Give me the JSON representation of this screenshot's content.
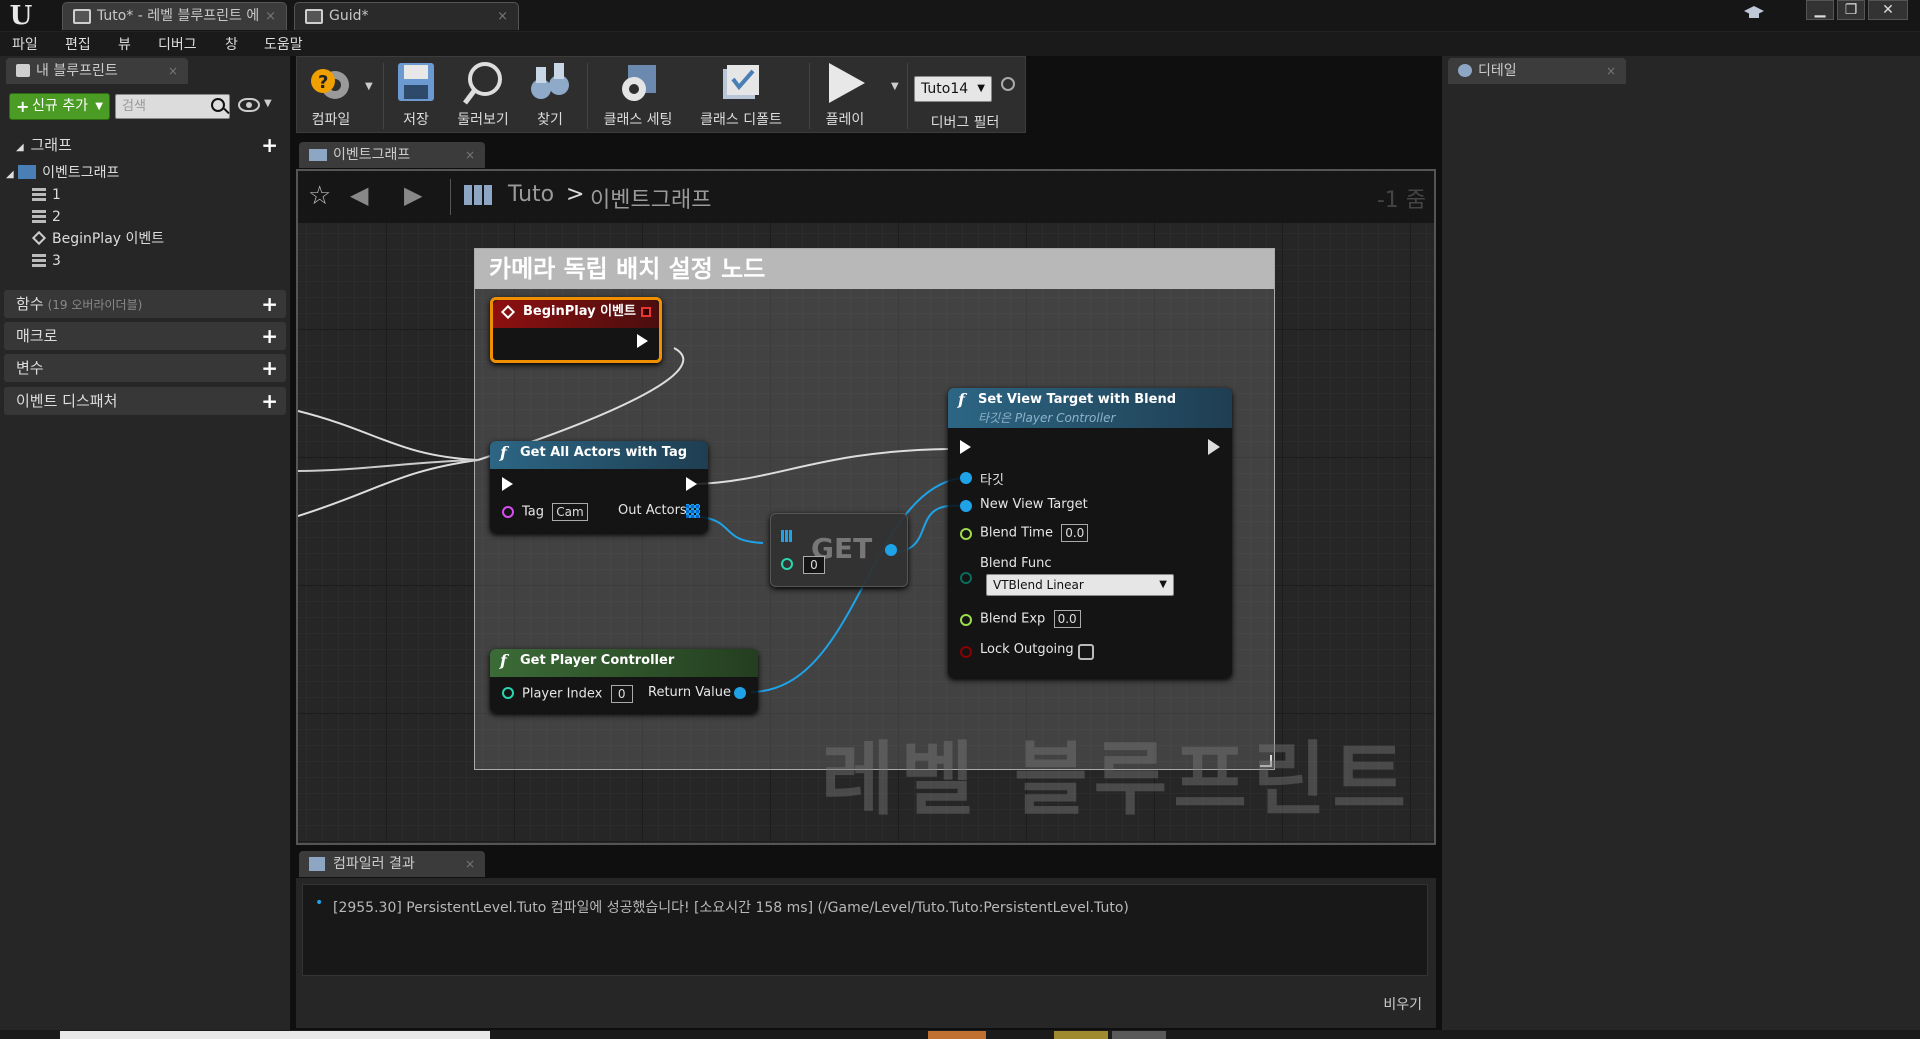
{
  "titlebar": {
    "tabs": [
      {
        "label": "Tuto* - 레벨 블루프린트 에"
      },
      {
        "label": "Guid*"
      }
    ],
    "close_glyph": "×"
  },
  "menu": [
    "파일",
    "편집",
    "뷰",
    "디버그",
    "창",
    "도움말"
  ],
  "left_panel": {
    "tab_label": "내 블루프린트",
    "add_button": "신규 추가",
    "search_placeholder": "검색",
    "graph_section": "그래프",
    "tree": {
      "root": "이벤트그래프",
      "items": [
        "1",
        "2",
        "BeginPlay 이벤트",
        "3"
      ]
    },
    "functions_label": "함수",
    "functions_sub": "(19 오버라이더블)",
    "macros_label": "매크로",
    "variables_label": "변수",
    "dispatchers_label": "이벤트 디스패처"
  },
  "toolbar": {
    "compile": "컴파일",
    "save": "저장",
    "browse": "둘러보기",
    "find": "찾기",
    "class_settings": "클래스 세팅",
    "class_defaults": "클래스 디폴트",
    "play": "플레이",
    "debug_object": "Tuto14",
    "debug_filter": "디버그 필터"
  },
  "graph": {
    "tab_label": "이벤트그래프",
    "breadcrumb_root": "Tuto",
    "breadcrumb_separator": ">",
    "breadcrumb_current": "이벤트그래프",
    "zoom": "-1 줌",
    "comment_title": "카메라 독립 배치 설정 노드",
    "watermark": "레벨 블루프린트",
    "nodes": {
      "beginplay": {
        "title": "BeginPlay 이벤트"
      },
      "get_all_actors": {
        "title": "Get All Actors with Tag",
        "tag_label": "Tag",
        "tag_value": "Cam",
        "out_label": "Out Actors"
      },
      "get_array": {
        "title": "GET",
        "index": "0"
      },
      "get_player_controller": {
        "title": "Get Player Controller",
        "index_label": "Player Index",
        "index_value": "0",
        "return_label": "Return Value"
      },
      "set_view_target": {
        "title": "Set View Target with Blend",
        "subtitle": "타깃은 Player Controller",
        "target": "타깃",
        "new_view_target": "New View Target",
        "blend_time_label": "Blend Time",
        "blend_time": "0.0",
        "blend_func_label": "Blend Func",
        "blend_func": "VTBlend Linear",
        "blend_exp_label": "Blend Exp",
        "blend_exp": "0.0",
        "lock_outgoing": "Lock Outgoing"
      }
    }
  },
  "compiler": {
    "tab_label": "컴파일러 결과",
    "log": "[2955.30] PersistentLevel.Tuto 컴파일에 성공했습니다! [소요시간 158 ms] (/Game/Level/Tuto.Tuto:PersistentLevel.Tuto)",
    "clear": "비우기"
  },
  "details": {
    "tab_label": "디테일"
  },
  "colors": {
    "exec_pin": "#ffffff",
    "object_pin": "#1fa3e8",
    "float_pin": "#9cdb4a",
    "byte_pin": "#0a6b5c",
    "bool_pin": "#8a0000",
    "string_pin": "#d84ff0",
    "int_pin": "#28d7b0",
    "event_header": "#8e1010",
    "function_header": "#2c6684",
    "pure_header": "#3b6b36",
    "compile_button": "#4a9c24"
  }
}
